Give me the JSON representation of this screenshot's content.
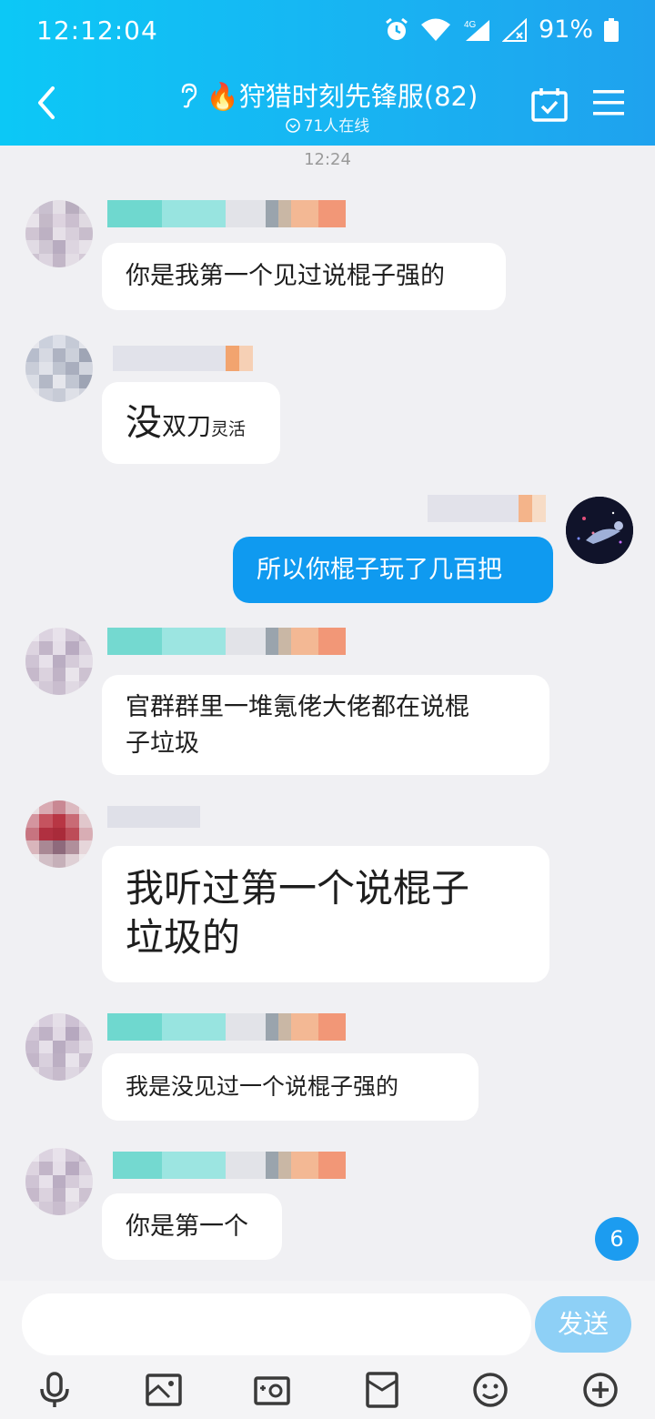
{
  "status_bar": {
    "time": "12:12:04",
    "battery": "91%"
  },
  "header": {
    "title": "🔥狩猎时刻先锋服(82)",
    "online": "71人在线"
  },
  "timestamp": "12:24",
  "messages": [
    {
      "text": "你是我第一个见过说棍子强的"
    },
    {
      "text_big": "没",
      "text_mid": "双刀",
      "text_small": "灵活"
    },
    {
      "text": "所以你棍子玩了几百把"
    },
    {
      "line1": "官群群里一堆氪佬大佬都在说棍",
      "line2": "子垃圾"
    },
    {
      "line1": "我听过第一个说棍子",
      "line2": "垃圾的"
    },
    {
      "text": "我是没见过一个说棍子强的"
    },
    {
      "text": "你是第一个"
    }
  ],
  "unread_badge": "6",
  "input": {
    "placeholder": "",
    "send_label": "发送"
  },
  "colors": {
    "header": "#19b2f2",
    "my_bubble": "#0f9af0",
    "send_button": "#8ed0f6"
  },
  "icons": [
    "back-arrow-icon",
    "ear-icon",
    "calendar-check-icon",
    "menu-icon",
    "microphone-icon",
    "image-icon",
    "camera-icon",
    "red-packet-icon",
    "emoji-icon",
    "plus-icon"
  ]
}
